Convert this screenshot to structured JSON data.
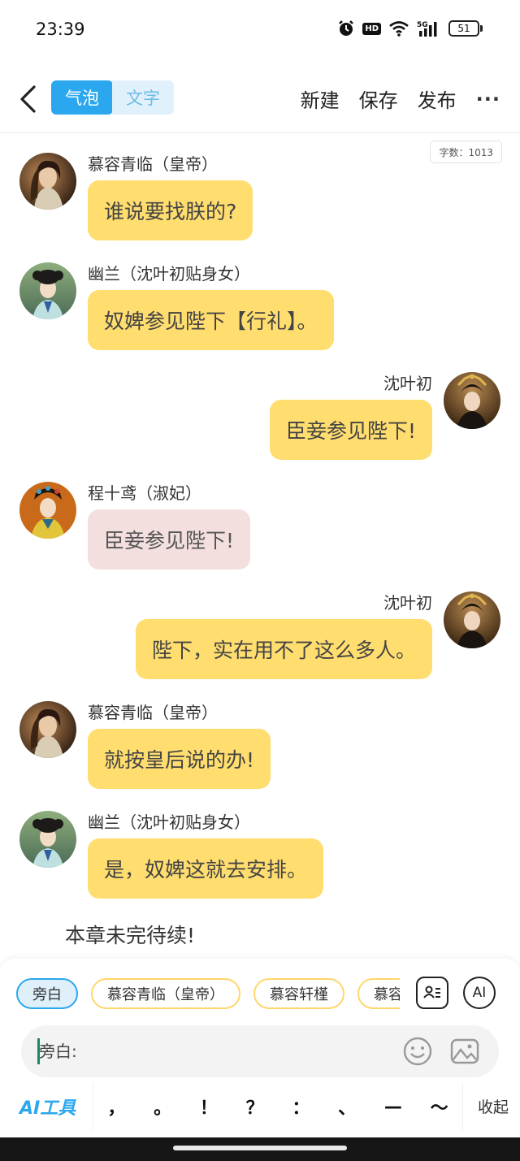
{
  "status_bar": {
    "time": "23:39",
    "hd": "HD",
    "network": "5G",
    "battery": "51"
  },
  "header": {
    "tabs": [
      {
        "label": "气泡",
        "active": true
      },
      {
        "label": "文字",
        "active": false
      }
    ],
    "actions": {
      "new": "新建",
      "save": "保存",
      "publish": "发布",
      "more": "···"
    }
  },
  "word_count": "字数：1013",
  "messages": [
    {
      "side": "left",
      "sender": "慕容青临（皇帝）",
      "text": "谁说要找朕的?",
      "bubble": "yellow",
      "avatar": "emperor"
    },
    {
      "side": "left",
      "sender": "幽兰（沈叶初贴身女）",
      "text": "奴婢参见陛下【行礼】。",
      "bubble": "yellow",
      "avatar": "maid"
    },
    {
      "side": "right",
      "sender": "沈叶初",
      "text": "臣妾参见陛下!",
      "bubble": "yellow",
      "avatar": "queen"
    },
    {
      "side": "left",
      "sender": "程十鸢（淑妃）",
      "text": "臣妾参见陛下!",
      "bubble": "pink",
      "avatar": "consort"
    },
    {
      "side": "right",
      "sender": "沈叶初",
      "text": "陛下，实在用不了这么多人。",
      "bubble": "yellow",
      "avatar": "queen"
    },
    {
      "side": "left",
      "sender": "慕容青临（皇帝）",
      "text": "就按皇后说的办!",
      "bubble": "yellow",
      "avatar": "emperor"
    },
    {
      "side": "left",
      "sender": "幽兰（沈叶初贴身女）",
      "text": "是，奴婢这就去安排。",
      "bubble": "yellow",
      "avatar": "maid"
    }
  ],
  "to_be_continued": "本章未完待续!",
  "composer": {
    "roles": [
      "旁白",
      "慕容青临（皇帝）",
      "慕容轩槿",
      "慕容"
    ],
    "active_role": "旁白",
    "ai_label": "AI",
    "input_placeholder": "旁白:",
    "ai_tools": "AI工具",
    "punctuation": [
      "，",
      "。",
      "！",
      "？",
      "：",
      "、",
      "—",
      "～"
    ],
    "collapse": "收起"
  },
  "colors": {
    "accent": "#2aa7ee",
    "bubble_yellow": "#ffdd6f",
    "bubble_pink": "#f4dfdf",
    "chip_border": "#ffd66a"
  },
  "icons": [
    "back-arrow-icon",
    "alarm-icon",
    "wifi-icon",
    "signal-icon",
    "battery-icon",
    "emoji-icon",
    "image-icon",
    "role-card-icon",
    "ai-icon"
  ]
}
